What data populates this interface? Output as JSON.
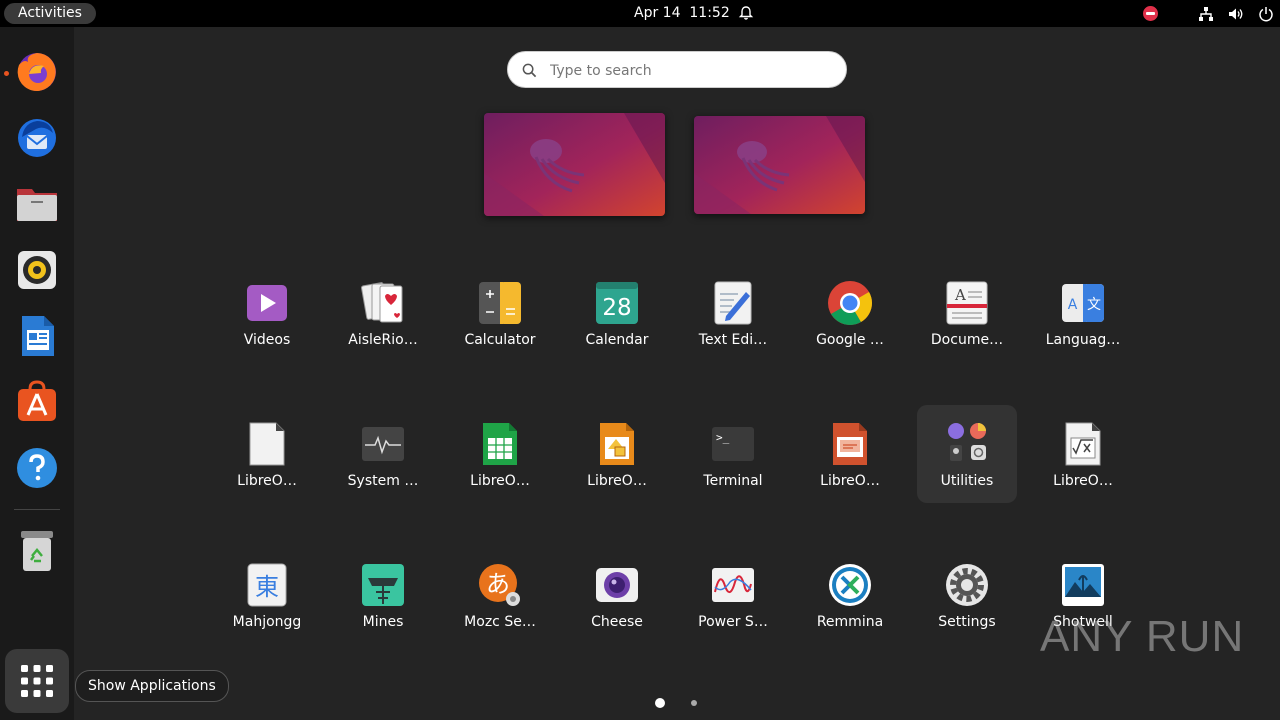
{
  "topbar": {
    "activities_label": "Activities",
    "date": "Apr 14",
    "time": "11:52"
  },
  "search": {
    "placeholder": "Type to search"
  },
  "apps": [
    {
      "label": "Videos"
    },
    {
      "label": "AisleRio…"
    },
    {
      "label": "Calculator"
    },
    {
      "label": "Calendar"
    },
    {
      "label": "Text Edi…"
    },
    {
      "label": "Google …"
    },
    {
      "label": "Docume…"
    },
    {
      "label": "Languag…"
    },
    {
      "label": "LibreO…"
    },
    {
      "label": "System …"
    },
    {
      "label": "LibreO…"
    },
    {
      "label": "LibreO…"
    },
    {
      "label": "Terminal"
    },
    {
      "label": "LibreO…"
    },
    {
      "label": "Utilities"
    },
    {
      "label": "LibreO…"
    },
    {
      "label": "Mahjongg"
    },
    {
      "label": "Mines"
    },
    {
      "label": "Mozc Se…"
    },
    {
      "label": "Cheese"
    },
    {
      "label": "Power S…"
    },
    {
      "label": "Remmina"
    },
    {
      "label": "Settings"
    },
    {
      "label": "Shotwell"
    }
  ],
  "calendar_icon_day": "28",
  "tooltip": "Show Applications",
  "watermark": "ANY RUN",
  "colors": {
    "accent": "#e95420",
    "background": "#242424",
    "topbar": "#000000"
  }
}
